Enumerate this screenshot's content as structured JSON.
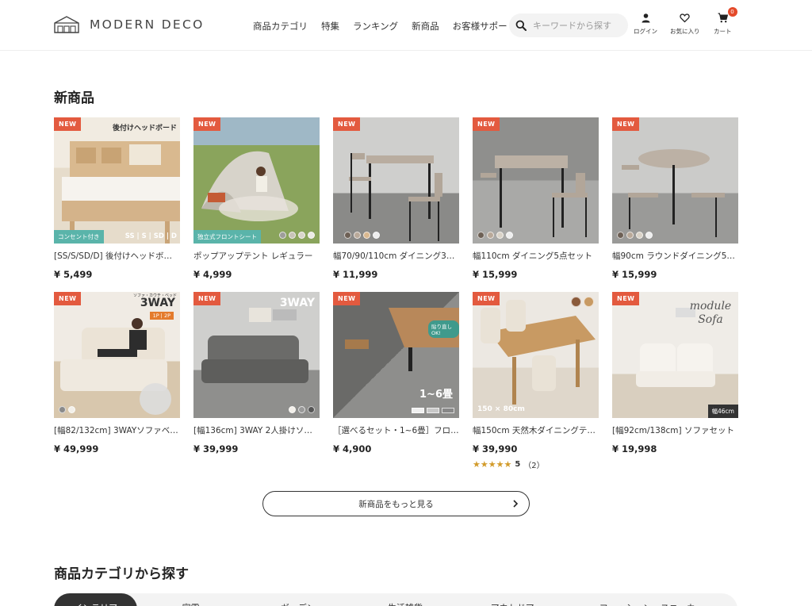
{
  "header": {
    "logo_text": "MODERN DECO",
    "nav": [
      "商品カテゴリ",
      "特集",
      "ランキング",
      "新商品",
      "お客様サポート"
    ],
    "search_placeholder": "キーワードから探す",
    "login_label": "ログイン",
    "favorites_label": "お気に入り",
    "cart_label": "カート",
    "cart_count": "0"
  },
  "new_section": {
    "title": "新商品",
    "new_tag": "NEW",
    "products": [
      {
        "name": "[SS/S/SD/D] 後付けヘッドボード",
        "price": "¥ 5,499",
        "img_caption": "後付けヘッドボード",
        "img_tag": "コンセント付き",
        "img_sizes": "SS | S | SD | D"
      },
      {
        "name": "ポップアップテント レギュラー",
        "price": "¥ 4,999",
        "img_tag": "独立式フロントシート"
      },
      {
        "name": "幅70/90/110cm ダイニング3点セット",
        "price": "¥ 11,999"
      },
      {
        "name": "幅110cm ダイニング5点セット",
        "price": "¥ 15,999"
      },
      {
        "name": "幅90cm ラウンドダイニング5点セット",
        "price": "¥ 15,999"
      },
      {
        "name": "[幅82/132cm] 3WAYソファベッド",
        "price": "¥ 49,999",
        "img_caption": "3WAY",
        "img_sub": "ソファ・カウチ・ベッド",
        "img_tag": "1P | 2P"
      },
      {
        "name": "[幅136cm] 3WAY 2人掛けソファ",
        "price": "¥ 39,999",
        "img_caption": "3WAY"
      },
      {
        "name": "［選べるセット・1~6畳］フロアマット",
        "price": "¥ 4,900",
        "img_caption": "1~6畳",
        "img_tag": "貼り直しOK!"
      },
      {
        "name": "幅150cm 天然木ダイニングテーブル",
        "price": "¥ 39,990",
        "img_caption": "150 × 80cm",
        "rating_stars": "★★★★★",
        "rating_value": "5",
        "rating_count": "（2）"
      },
      {
        "name": "[幅92cm/138cm] ソファセット",
        "price": "¥ 19,998",
        "img_caption": "module Sofa",
        "img_tag": "幅46cm"
      }
    ],
    "more_label": "新商品をもっと見る"
  },
  "category_section": {
    "title": "商品カテゴリから探す",
    "tabs": [
      "インテリア",
      "家電",
      "ガーデン",
      "生活雑貨",
      "アウトドア",
      "ファッション・スニーカー"
    ]
  },
  "colors": {
    "accent": "#e35a3f",
    "star": "#d29b2a",
    "dark": "#333333"
  }
}
